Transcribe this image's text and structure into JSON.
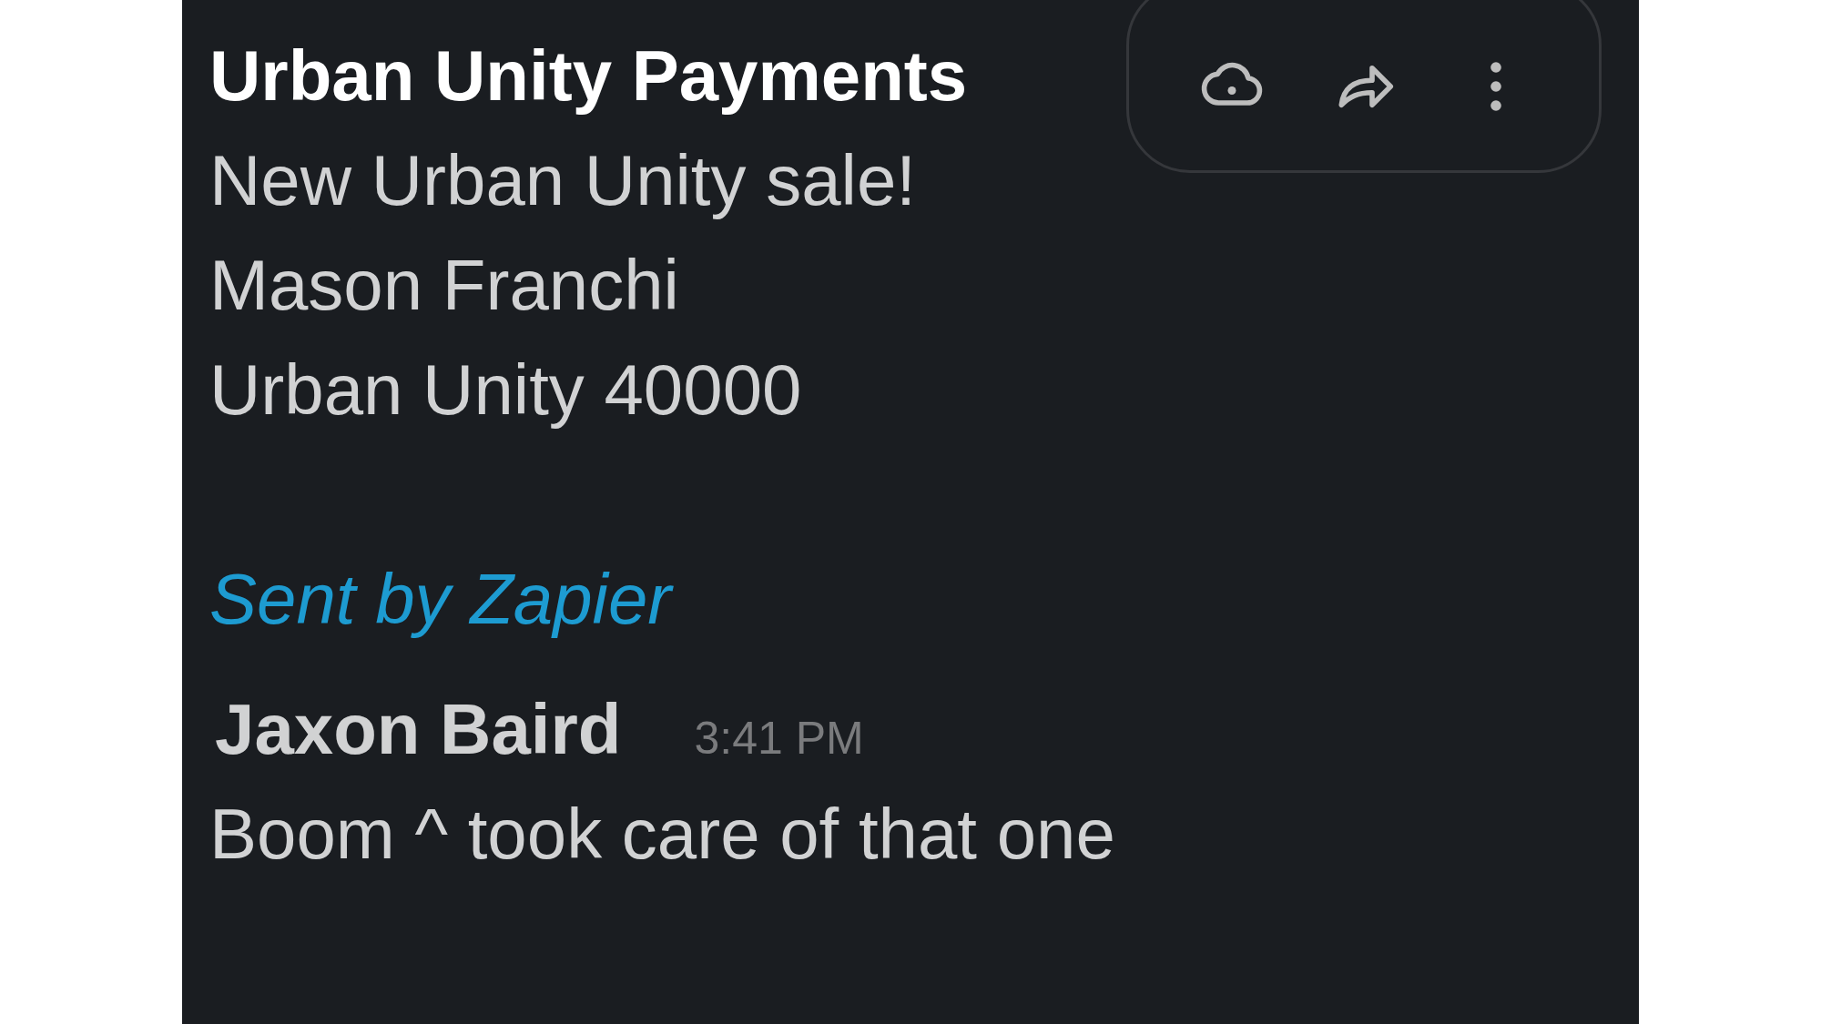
{
  "message": {
    "sender": "Urban Unity Payments",
    "lines": [
      "New Urban Unity sale!",
      "Mason Franchi",
      "Urban Unity 40000"
    ],
    "footer_link": "Sent by Zapier"
  },
  "reply": {
    "sender": "Jaxon Baird",
    "time": "3:41 PM",
    "text": "Boom ^ took care of that one"
  },
  "hover_toolbar": {
    "actions": [
      {
        "kind": "reaction"
      },
      {
        "kind": "share"
      },
      {
        "kind": "more"
      }
    ]
  }
}
